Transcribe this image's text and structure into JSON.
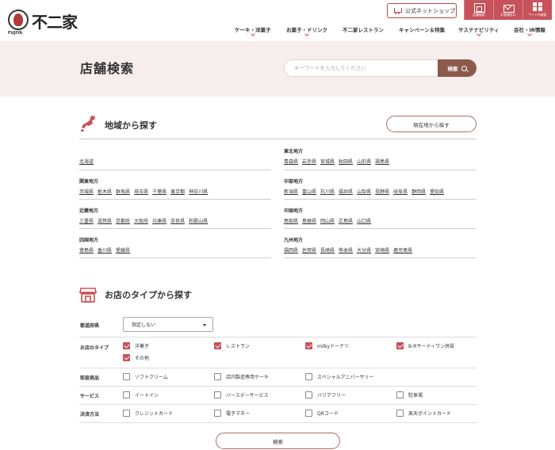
{
  "header": {
    "logo_text": "不二家",
    "logo_sub": "FUJIYA",
    "online_shop": "公式ネットショップ",
    "top_buttons": [
      "店舗検索",
      "お客様窓口",
      "サイト内検索"
    ],
    "nav": [
      "ケーキ・洋菓子",
      "お菓子・ドリンク",
      "不二家レストラン",
      "キャンペーン＆特集",
      "サステナビリティ",
      "会社・IR情報"
    ]
  },
  "hero": {
    "title": "店舗検索",
    "search_placeholder": "キーワードを入力してください",
    "search_button": "検索"
  },
  "region_section": {
    "title": "地域から探す",
    "current_location_button": "現在地から探す",
    "regions": [
      {
        "name": "",
        "prefs": [
          "北海道"
        ]
      },
      {
        "name": "東北地方",
        "prefs": [
          "青森県",
          "岩手県",
          "宮城県",
          "秋田県",
          "山形県",
          "福島県"
        ]
      },
      {
        "name": "関東地方",
        "prefs": [
          "茨城県",
          "栃木県",
          "群馬県",
          "埼玉県",
          "千葉県",
          "東京都",
          "神奈川県"
        ]
      },
      {
        "name": "中部地方",
        "prefs": [
          "新潟県",
          "富山県",
          "石川県",
          "福井県",
          "山梨県",
          "長野県",
          "岐阜県",
          "静岡県",
          "愛知県"
        ]
      },
      {
        "name": "近畿地方",
        "prefs": [
          "三重県",
          "滋賀県",
          "京都府",
          "大阪府",
          "兵庫県",
          "奈良県",
          "和歌山県"
        ]
      },
      {
        "name": "中国地方",
        "prefs": [
          "鳥取県",
          "島根県",
          "岡山県",
          "広島県",
          "山口県"
        ]
      },
      {
        "name": "四国地方",
        "prefs": [
          "徳島県",
          "香川県",
          "愛媛県"
        ]
      },
      {
        "name": "九州地方",
        "prefs": [
          "福岡県",
          "佐賀県",
          "長崎県",
          "熊本県",
          "大分県",
          "宮崎県",
          "鹿児島県"
        ]
      }
    ]
  },
  "type_section": {
    "title": "お店のタイプから探す",
    "pref_label": "都道府県",
    "pref_select": "指定しない",
    "shop_type_label": "お店のタイプ",
    "shop_types": [
      {
        "label": "洋菓子",
        "checked": true
      },
      {
        "label": "レストラン",
        "checked": true
      },
      {
        "label": "milkyドーナツ",
        "checked": true
      },
      {
        "label": "B-Rサーティワン併設",
        "checked": true
      },
      {
        "label": "その他",
        "checked": true
      }
    ],
    "products_label": "取扱商品",
    "products": [
      {
        "label": "ソフトクリーム",
        "checked": false
      },
      {
        "label": "店内製造専用ケーキ",
        "checked": false
      },
      {
        "label": "スペシャルアニバーサリー",
        "checked": false
      }
    ],
    "services_label": "サービス",
    "services": [
      {
        "label": "イートイン",
        "checked": false
      },
      {
        "label": "バースデーサービス",
        "checked": false
      },
      {
        "label": "バリアフリー",
        "checked": false
      },
      {
        "label": "駐車場",
        "checked": false
      }
    ],
    "payment_label": "決済方法",
    "payments": [
      {
        "label": "クレジットカード",
        "checked": false
      },
      {
        "label": "電子マネー",
        "checked": false
      },
      {
        "label": "QRコード",
        "checked": false
      },
      {
        "label": "楽天ポイントカード",
        "checked": false
      }
    ],
    "submit": "検索"
  },
  "colors": {
    "accent": "#c7525a",
    "search_button": "#8b5a4b",
    "hero_bg": "#f6eded"
  }
}
